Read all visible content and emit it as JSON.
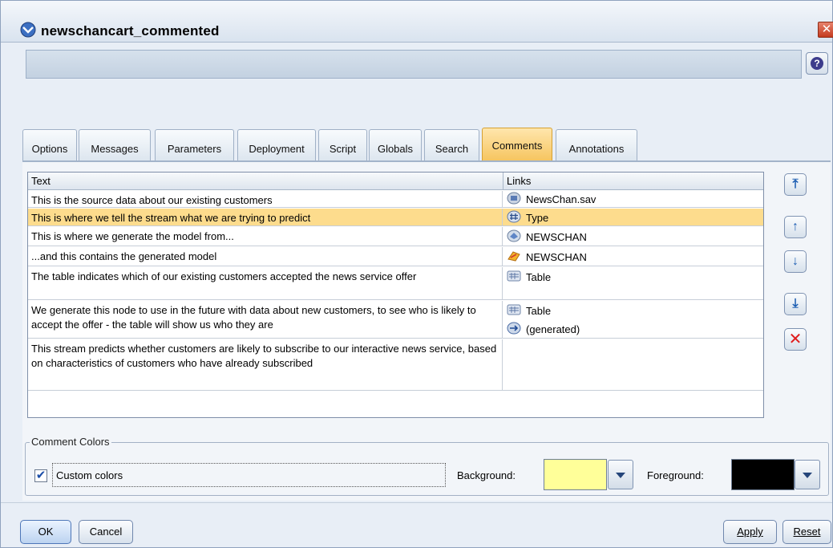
{
  "window": {
    "title": "newschancart_commented",
    "close_glyph": "✕",
    "help_glyph": "?"
  },
  "tabs": [
    {
      "label": "Options",
      "active": false
    },
    {
      "label": "Messages",
      "active": false
    },
    {
      "label": "Parameters",
      "active": false
    },
    {
      "label": "Deployment",
      "active": false
    },
    {
      "label": "Script",
      "active": false
    },
    {
      "label": "Globals",
      "active": false
    },
    {
      "label": "Search",
      "active": false
    },
    {
      "label": "Comments",
      "active": true
    },
    {
      "label": "Annotations",
      "active": false
    }
  ],
  "table": {
    "headers": {
      "text": "Text",
      "links": "Links"
    },
    "rows": [
      {
        "text": "This is the source data about our existing customers",
        "selected": false,
        "links": [
          {
            "label": "NewsChan.sav",
            "icon": "spss-file-icon"
          }
        ]
      },
      {
        "text": "This is where we tell the stream what we are trying to predict",
        "selected": true,
        "links": [
          {
            "label": "Type",
            "icon": "type-node-icon"
          }
        ]
      },
      {
        "text": "This is where we generate the model from...",
        "selected": false,
        "links": [
          {
            "label": "NEWSCHAN",
            "icon": "model-builder-icon"
          }
        ]
      },
      {
        "text": "...and this contains the generated model",
        "selected": false,
        "links": [
          {
            "label": "NEWSCHAN",
            "icon": "model-nugget-icon"
          }
        ]
      },
      {
        "text": "The table indicates which of our existing customers accepted the news service offer",
        "selected": false,
        "links": [
          {
            "label": "Table",
            "icon": "table-node-icon"
          }
        ]
      },
      {
        "text": "We generate this node to use in the future with data about new customers, to see who is likely to accept the offer - the table will show us who they are",
        "selected": false,
        "links": [
          {
            "label": "Table",
            "icon": "table-node-icon"
          },
          {
            "label": "(generated)",
            "icon": "generated-node-icon"
          }
        ]
      },
      {
        "text": "This stream predicts whether customers are likely to subscribe to our interactive news service, based on characteristics of customers who have already subscribed",
        "selected": false,
        "links": []
      }
    ]
  },
  "side_buttons": [
    {
      "name": "move-to-top-button",
      "glyph": "⤒"
    },
    {
      "name": "move-up-button",
      "glyph": "↑"
    },
    {
      "name": "move-down-button",
      "glyph": "↓"
    },
    {
      "name": "move-to-bottom-button",
      "glyph": "⤓"
    },
    {
      "name": "delete-comment-button",
      "glyph": "✕"
    }
  ],
  "comment_colors": {
    "group_title": "Comment Colors",
    "checkbox_label": "Custom colors",
    "checkbox_checked": true,
    "checkbox_glyph": "✔",
    "background_label": "Background:",
    "background_color": "#ffff99",
    "foreground_label": "Foreground:",
    "foreground_color": "#000000"
  },
  "buttons": {
    "ok": "OK",
    "cancel": "Cancel",
    "apply": "Apply",
    "reset": "Reset"
  },
  "colors": {
    "selected_row": "#fddc8d",
    "active_tab": "#f6c560"
  }
}
